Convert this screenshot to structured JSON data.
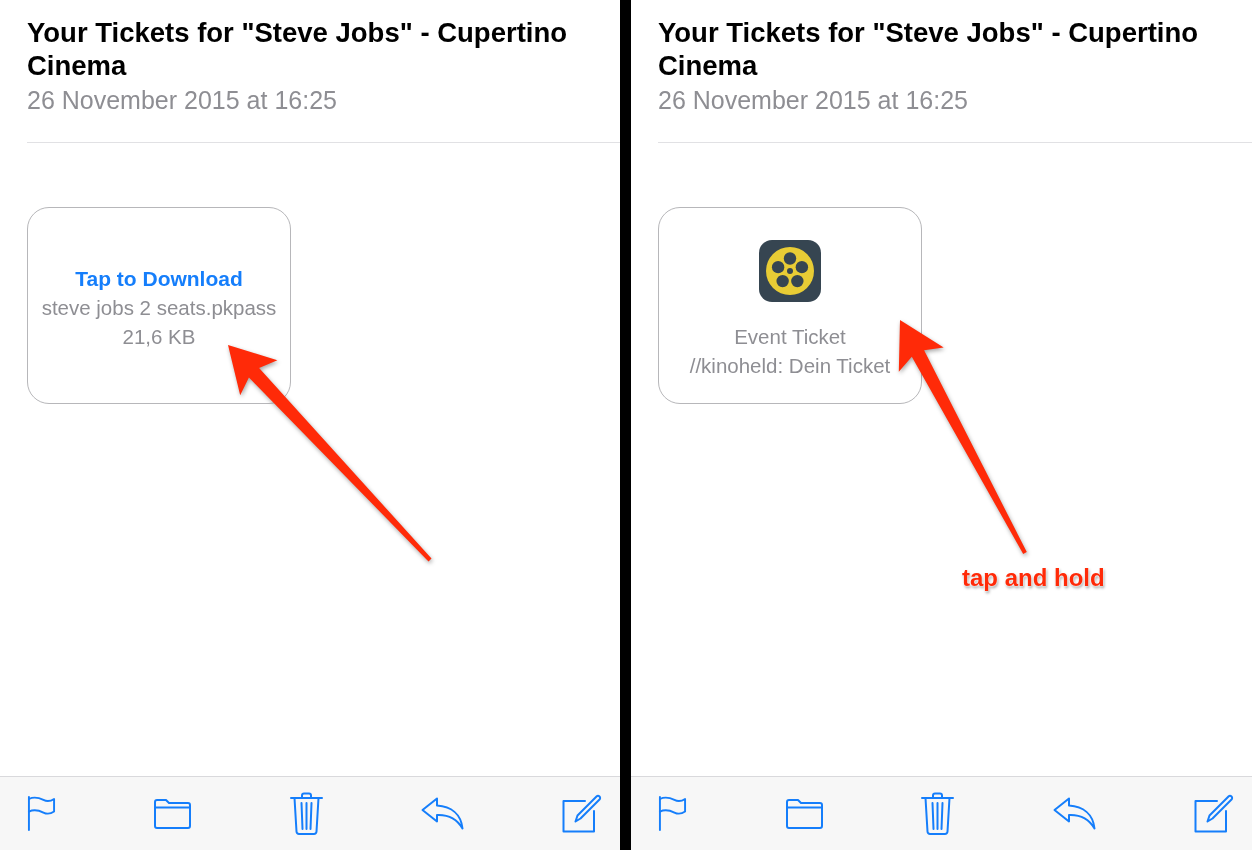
{
  "panels": [
    {
      "subject": "Your Tickets for \"Steve Jobs\" - Cupertino Cinema",
      "date": "26 November 2015 at 16:25",
      "attachment": {
        "kind": "download",
        "action": "Tap to Download",
        "file_name": "steve jobs 2 seats.pkpass",
        "file_size": "21,6 KB"
      },
      "annotation": {
        "arrow": true
      }
    },
    {
      "subject": "Your Tickets for \"Steve Jobs\" - Cupertino Cinema",
      "date": "26 November 2015 at 16:25",
      "attachment": {
        "kind": "pass",
        "pass_type": "Event Ticket",
        "description": "//kinoheld: Dein Ticket"
      },
      "annotation": {
        "arrow": true,
        "label": "tap and hold"
      }
    }
  ]
}
